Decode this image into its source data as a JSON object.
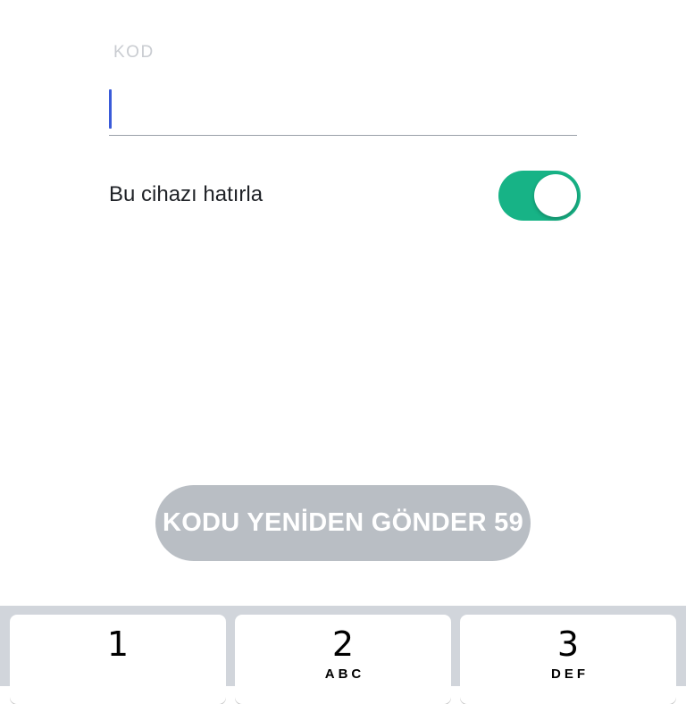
{
  "form": {
    "code_label": "KOD",
    "code_value": "",
    "remember_label": "Bu cihazı hatırla",
    "remember_enabled": true,
    "toggle_color": "#17b386"
  },
  "resend": {
    "label": "KODU YENİDEN GÖNDER 59"
  },
  "keypad": {
    "keys": [
      {
        "digit": "1",
        "letters": ""
      },
      {
        "digit": "2",
        "letters": "ABC"
      },
      {
        "digit": "3",
        "letters": "DEF"
      }
    ]
  }
}
